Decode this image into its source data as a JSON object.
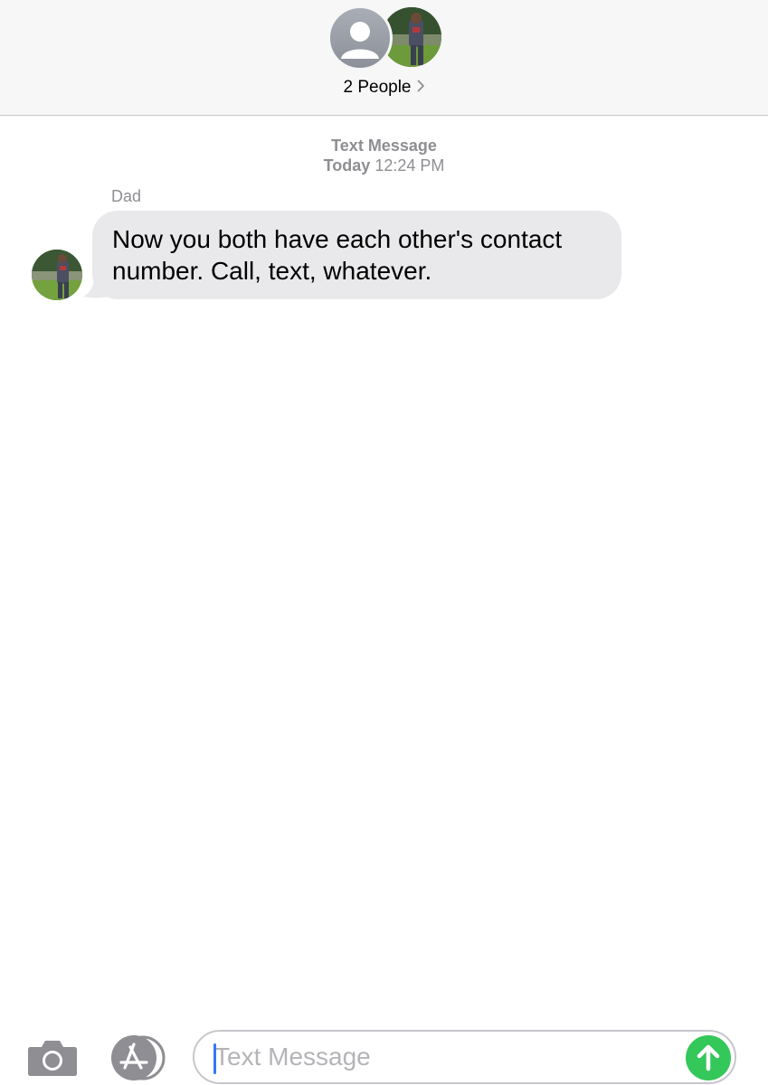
{
  "header": {
    "people_label": "2 People",
    "icons": {
      "default_avatar": "person-silhouette-icon",
      "photo_avatar": "contact-photo",
      "chevron": "chevron-right-icon"
    }
  },
  "conversation": {
    "service_label": "Text Message",
    "date_label": "Today",
    "time_label": "12:24 PM",
    "messages": [
      {
        "sender": "Dad",
        "text": "Now you both have each other's contact number. Call, text, whatever."
      }
    ]
  },
  "composer": {
    "placeholder": "Text Message",
    "value": "",
    "icons": {
      "camera": "camera-icon",
      "apps": "app-store-icon",
      "send": "send-arrow-up-icon"
    }
  },
  "colors": {
    "header_bg": "#f7f7f7",
    "bubble_received": "#e9e9eb",
    "send_button": "#34c759",
    "cursor": "#3478f6",
    "meta_text": "#8e8e93"
  }
}
